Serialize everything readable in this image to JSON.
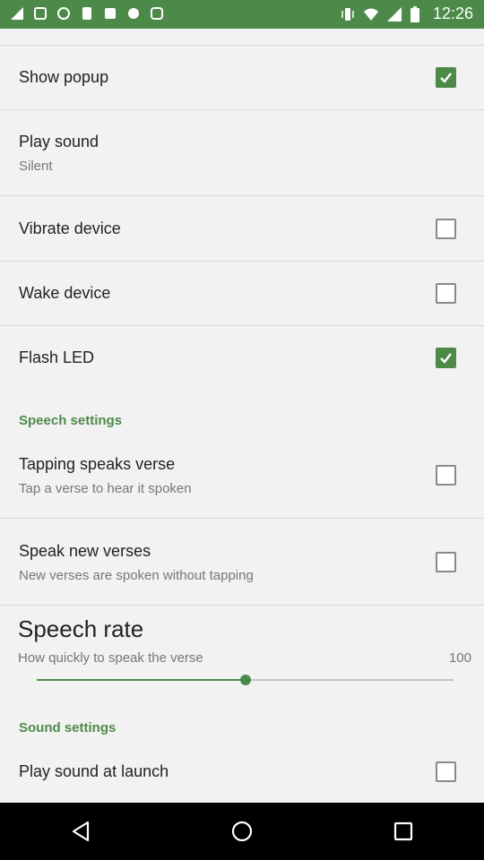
{
  "status_bar": {
    "time": "12:26",
    "left_icons": [
      "signal-fill-icon",
      "notification-icon",
      "notification-icon",
      "notification-icon",
      "notification-icon",
      "notification-icon",
      "notification-icon"
    ],
    "right_icons": [
      "vibrate-icon",
      "wifi-icon",
      "signal-icon",
      "battery-icon"
    ]
  },
  "settings": {
    "show_popup": {
      "title": "Show popup",
      "checked": true
    },
    "play_sound": {
      "title": "Play sound",
      "subtitle": "Silent"
    },
    "vibrate_device": {
      "title": "Vibrate device",
      "checked": false
    },
    "wake_device": {
      "title": "Wake device",
      "checked": false
    },
    "flash_led": {
      "title": "Flash LED",
      "checked": true
    }
  },
  "speech_settings": {
    "header": "Speech settings",
    "tapping_speaks_verse": {
      "title": "Tapping speaks verse",
      "subtitle": "Tap a verse to hear it spoken",
      "checked": false
    },
    "speak_new_verses": {
      "title": "Speak new verses",
      "subtitle": "New verses are spoken without tapping",
      "checked": false
    },
    "speech_rate": {
      "title": "Speech rate",
      "subtitle": "How quickly to speak the verse",
      "value": "100",
      "fraction": 0.5
    }
  },
  "sound_settings": {
    "header": "Sound settings",
    "play_sound_at_launch": {
      "title": "Play sound at launch",
      "checked": false
    }
  },
  "nav_bar": {
    "buttons": [
      "back-icon",
      "home-icon",
      "recents-icon"
    ]
  },
  "colors": {
    "accent": "#4d8a4a",
    "status_bar": "#4d8a4a",
    "background": "#f2f2f2",
    "nav_bar": "#000000"
  }
}
